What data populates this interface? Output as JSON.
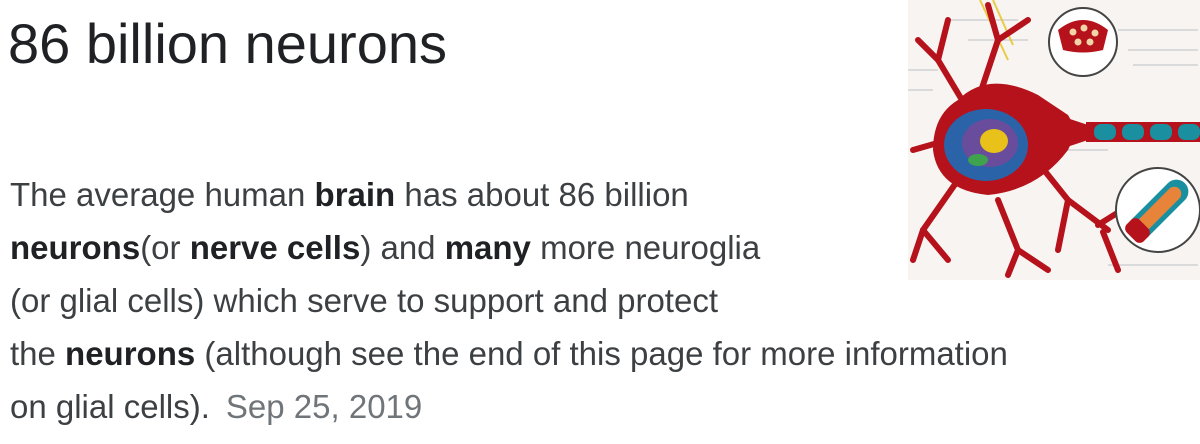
{
  "answer": {
    "headline": "86 billion neurons",
    "snippet": {
      "lines": [
        [
          {
            "text": "The average human ",
            "bold": false
          },
          {
            "text": "brain",
            "bold": true
          },
          {
            "text": " has about 86 billion",
            "bold": false
          }
        ],
        [
          {
            "text": "neurons",
            "bold": true
          },
          {
            "text": "(or ",
            "bold": false
          },
          {
            "text": "nerve cells",
            "bold": true
          },
          {
            "text": ") and ",
            "bold": false
          },
          {
            "text": "many",
            "bold": true
          },
          {
            "text": " more neuroglia",
            "bold": false
          }
        ],
        [
          {
            "text": "(or glial cells) which serve to support and protect",
            "bold": false
          }
        ],
        [
          {
            "text": "the ",
            "bold": false
          },
          {
            "text": "neurons",
            "bold": true
          },
          {
            "text": " (although see the end of this page for more information",
            "bold": false
          }
        ],
        [
          {
            "text": "on glial cells).",
            "bold": false
          }
        ]
      ],
      "date": "Sep 25, 2019"
    },
    "thumbnail": {
      "icon": "neuron-diagram-image",
      "colors": {
        "membrane": "#b5121b",
        "nucleus_blue": "#2b63a8",
        "nucleolus_yellow": "#e8c21a",
        "axon_teal": "#1a8fa0",
        "background": "#f7f4f1"
      }
    }
  }
}
